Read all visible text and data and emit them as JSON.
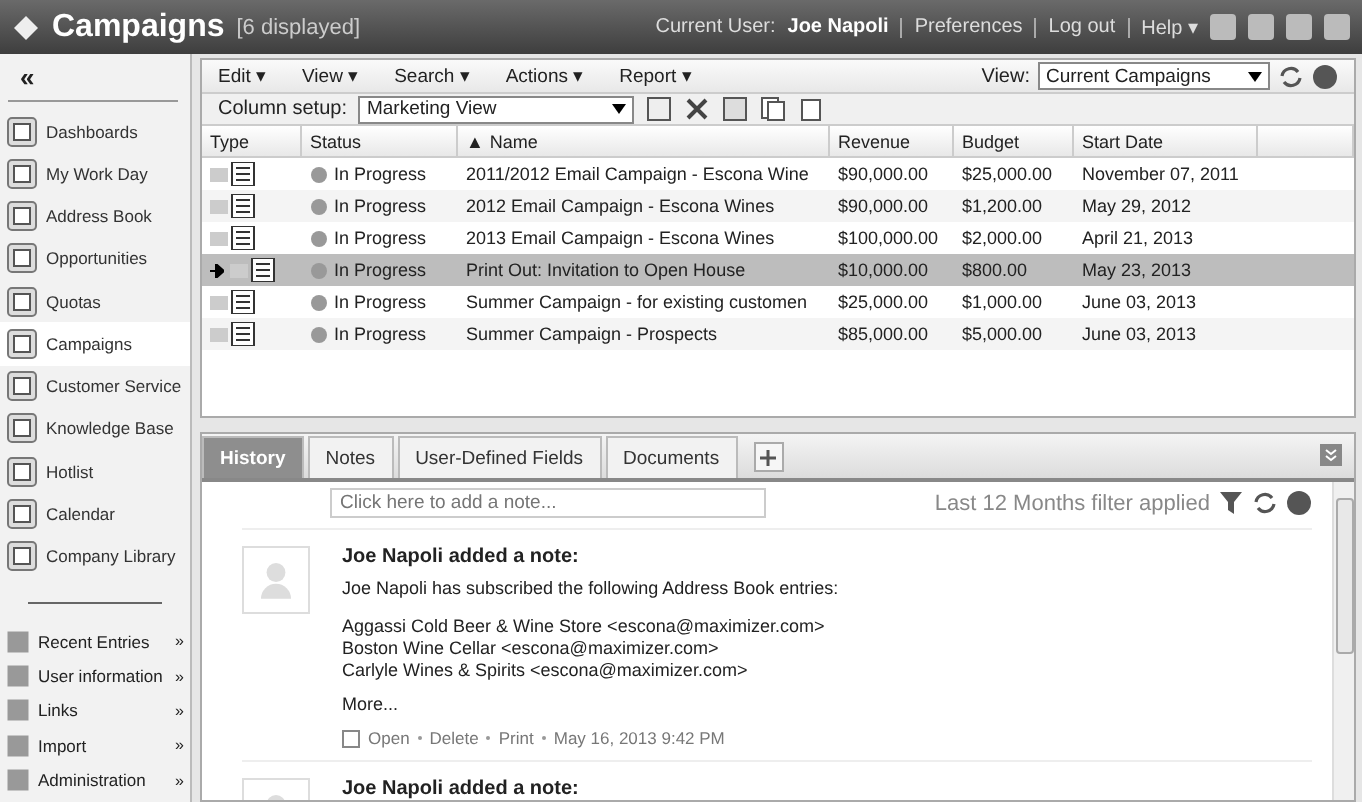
{
  "header": {
    "title": "Campaigns",
    "count": "[6 displayed]",
    "user_label": "Current User:",
    "user_name": "Joe Napoli",
    "links": [
      "Preferences",
      "Log out",
      "Help ▾"
    ]
  },
  "sidebar": {
    "collapse": "«",
    "items": [
      {
        "label": "Dashboards",
        "selected": false
      },
      {
        "label": "My Work Day",
        "selected": false
      },
      {
        "label": "Address Book",
        "selected": false
      },
      {
        "label": "Opportunities",
        "selected": false
      },
      {
        "label": "Quotas",
        "selected": false
      },
      {
        "label": "Campaigns",
        "selected": true
      },
      {
        "label": "Customer Service",
        "selected": false
      },
      {
        "label": "Knowledge Base",
        "selected": false
      },
      {
        "label": "Hotlist",
        "selected": false
      },
      {
        "label": "Calendar",
        "selected": false
      },
      {
        "label": "Company Library",
        "selected": false
      }
    ],
    "extras": [
      {
        "label": "Recent Entries",
        "mark": "»"
      },
      {
        "label": "User information",
        "mark": "»"
      },
      {
        "label": "Links",
        "mark": "»"
      },
      {
        "label": "Import",
        "mark": "»"
      },
      {
        "label": "Administration",
        "mark": "»"
      }
    ]
  },
  "toolbar": {
    "menus": [
      "Edit ▾",
      "View ▾",
      "Search ▾",
      "Actions ▾",
      "Report ▾"
    ],
    "view_label": "View:",
    "view_value": "Current Campaigns"
  },
  "column_setup": {
    "label": "Column setup:",
    "value": "Marketing View"
  },
  "table": {
    "columns": [
      {
        "label": "Type",
        "sorted": false
      },
      {
        "label": "Status",
        "sorted": false
      },
      {
        "label": "Name",
        "sorted": true
      },
      {
        "label": "Revenue",
        "sorted": false
      },
      {
        "label": "Budget",
        "sorted": false
      },
      {
        "label": "Start Date",
        "sorted": false
      }
    ],
    "sort_mark": "▲",
    "rows": [
      {
        "status": "In Progress",
        "name": "2011/2012 Email Campaign - Escona Wine",
        "revenue": "$90,000.00",
        "budget": "$25,000.00",
        "start_date": "November 07, 2011",
        "selected": false
      },
      {
        "status": "In Progress",
        "name": "2012 Email Campaign - Escona Wines",
        "revenue": "$90,000.00",
        "budget": "$1,200.00",
        "start_date": "May 29, 2012",
        "selected": false
      },
      {
        "status": "In Progress",
        "name": "2013 Email Campaign - Escona Wines",
        "revenue": "$100,000.00",
        "budget": "$2,000.00",
        "start_date": "April 21, 2013",
        "selected": false
      },
      {
        "status": "In Progress",
        "name": "Print Out: Invitation to Open House",
        "revenue": "$10,000.00",
        "budget": "$800.00",
        "start_date": "May 23, 2013",
        "selected": true
      },
      {
        "status": "In Progress",
        "name": "Summer Campaign - for existing customen",
        "revenue": "$25,000.00",
        "budget": "$1,000.00",
        "start_date": "June 03, 2013",
        "selected": false
      },
      {
        "status": "In Progress",
        "name": "Summer Campaign - Prospects",
        "revenue": "$85,000.00",
        "budget": "$5,000.00",
        "start_date": "June 03, 2013",
        "selected": false
      }
    ]
  },
  "tabs": [
    {
      "label": "History",
      "selected": true
    },
    {
      "label": "Notes",
      "selected": false
    },
    {
      "label": "User-Defined Fields",
      "selected": false
    },
    {
      "label": "Documents",
      "selected": false
    }
  ],
  "note_input": {
    "placeholder": "Click here to add a note..."
  },
  "filter_text": "Last 12 Months filter applied",
  "notes": [
    {
      "author": "Joe Napoli",
      "action": "added a note:",
      "body": "Joe Napoli has subscribed the following Address Book entries:",
      "entries": [
        "Aggassi Cold Beer & Wine Store <escona@maximizer.com>",
        "Boston Wine Cellar <escona@maximizer.com>",
        "Carlyle Wines & Spirits <escona@maximizer.com>"
      ],
      "more": "More...",
      "actions": [
        "Open",
        "Delete",
        "Print"
      ],
      "date": "May 16, 2013 9:42 PM"
    },
    {
      "author": "Joe Napoli",
      "action": "added a note:"
    }
  ]
}
